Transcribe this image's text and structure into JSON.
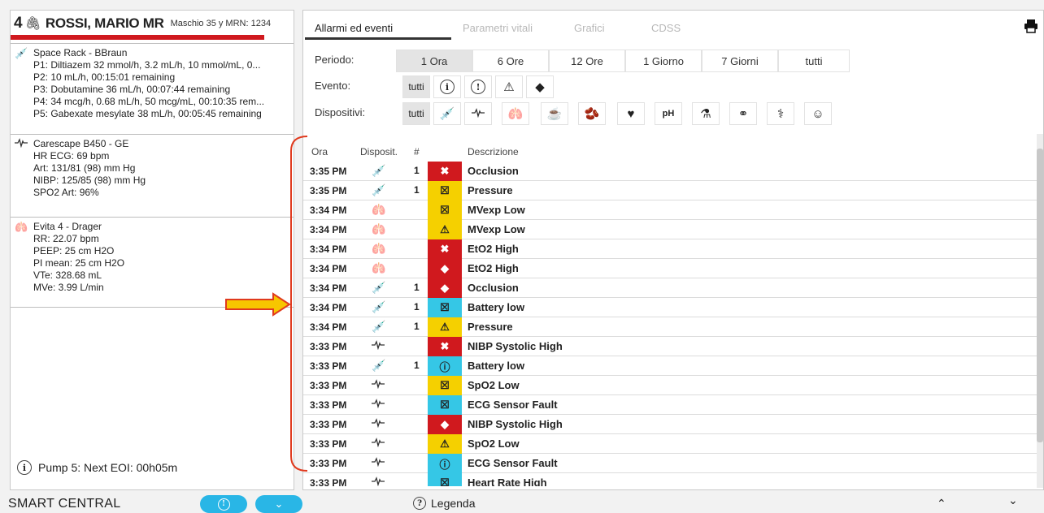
{
  "patient": {
    "bed": "4",
    "name": "ROSSI, MARIO MR",
    "info": "Maschio 35 y MRN: 1234"
  },
  "devices": [
    {
      "icon": "syringe-icon",
      "title": "Space Rack - BBraun",
      "lines": [
        "P1: Diltiazem 32 mmol/h, 3.2 mL/h, 10 mmol/mL, 0...",
        "P2: 10 mL/h, 00:15:01 remaining",
        "P3: Dobutamine 36 mL/h, 00:07:44 remaining",
        "P4: 34 mcg/h, 0.68 mL/h, 50 mcg/mL, 00:10:35 rem...",
        "P5: Gabexate mesylate 38 mL/h, 00:05:45 remaining"
      ]
    },
    {
      "icon": "ecg-waveform-icon",
      "title": "Carescape B450 - GE",
      "lines": [
        "HR ECG: 69 bpm",
        "Art: 131/81 (98) mm Hg",
        "NIBP: 125/85 (98) mm Hg",
        "SPO2 Art: 96%"
      ]
    },
    {
      "icon": "lungs-icon",
      "title": "Evita 4 - Drager",
      "lines": [
        "RR: 22.07 bpm",
        "PEEP: 25 cm H2O",
        "PI mean: 25 cm H2O",
        "VTe: 328.68 mL",
        "MVe: 3.99 L/min"
      ]
    }
  ],
  "eoi_text": "Pump 5: Next EOI: 00h05m",
  "tabs": [
    "Allarmi ed eventi",
    "Parametri vitali",
    "Grafici",
    "CDSS"
  ],
  "filters": {
    "periodo_label": "Periodo:",
    "periodo_options": [
      "1 Ora",
      "6 Ore",
      "12 Ore",
      "1 Giorno",
      "7 Giorni",
      "tutti"
    ],
    "evento_label": "Evento:",
    "evento_all": "tutti",
    "evento_icons": [
      "info-icon",
      "alert-circle-icon",
      "warning-triangle-icon",
      "critical-diamond-icon"
    ],
    "dispositivi_label": "Dispositivi:",
    "dispositivi_all": "tutti",
    "dispositivi_icons": [
      "syringe-icon",
      "ecg-waveform-icon",
      "lungs-icon",
      "nutrition-pump-icon",
      "kidney-icon",
      "heart-icon",
      "ph-icon",
      "flask-icon",
      "bandage-icon",
      "stethoscope-icon",
      "person-icon"
    ],
    "ph_text": "pH"
  },
  "table": {
    "headers": [
      "Ora",
      "Disposit.",
      "#",
      "Descrizione"
    ],
    "rows": [
      {
        "time": "3:35 PM",
        "device": "syringe",
        "num": "1",
        "sev": "red-cross",
        "desc": "Occlusion"
      },
      {
        "time": "3:35 PM",
        "device": "syringe",
        "num": "1",
        "sev": "yellow-x",
        "desc": "Pressure"
      },
      {
        "time": "3:34 PM",
        "device": "lungs",
        "num": "",
        "sev": "yellow-x",
        "desc": "MVexp Low"
      },
      {
        "time": "3:34 PM",
        "device": "lungs",
        "num": "",
        "sev": "yellow-warn",
        "desc": "MVexp Low"
      },
      {
        "time": "3:34 PM",
        "device": "lungs",
        "num": "",
        "sev": "red-cross",
        "desc": "EtO2 High"
      },
      {
        "time": "3:34 PM",
        "device": "lungs",
        "num": "",
        "sev": "red-diamond",
        "desc": "EtO2 High"
      },
      {
        "time": "3:34 PM",
        "device": "syringe",
        "num": "1",
        "sev": "red-diamond",
        "desc": "Occlusion"
      },
      {
        "time": "3:34 PM",
        "device": "syringe",
        "num": "1",
        "sev": "blue-x",
        "desc": "Battery low"
      },
      {
        "time": "3:34 PM",
        "device": "syringe",
        "num": "1",
        "sev": "yellow-warn",
        "desc": "Pressure"
      },
      {
        "time": "3:33 PM",
        "device": "ecg",
        "num": "",
        "sev": "red-cross",
        "desc": "NIBP Systolic High"
      },
      {
        "time": "3:33 PM",
        "device": "syringe",
        "num": "1",
        "sev": "blue-circle",
        "desc": "Battery low"
      },
      {
        "time": "3:33 PM",
        "device": "ecg",
        "num": "",
        "sev": "yellow-x",
        "desc": "SpO2 Low"
      },
      {
        "time": "3:33 PM",
        "device": "ecg",
        "num": "",
        "sev": "blue-x",
        "desc": "ECG Sensor Fault"
      },
      {
        "time": "3:33 PM",
        "device": "ecg",
        "num": "",
        "sev": "red-diamond",
        "desc": "NIBP Systolic High"
      },
      {
        "time": "3:33 PM",
        "device": "ecg",
        "num": "",
        "sev": "yellow-warn",
        "desc": "SpO2 Low"
      },
      {
        "time": "3:33 PM",
        "device": "ecg",
        "num": "",
        "sev": "blue-circle",
        "desc": "ECG Sensor Fault"
      },
      {
        "time": "3:33 PM",
        "device": "ecg",
        "num": "",
        "sev": "blue-x",
        "desc": "Heart Rate High"
      }
    ]
  },
  "bottom": {
    "app_name": "SMART CENTRAL",
    "legend": "Legenda"
  },
  "colors": {
    "red": "#d0191e",
    "yellow": "#f5d000",
    "blue": "#35c7e6",
    "accent": "#29b6e6",
    "annotation": "#e03a1e",
    "arrow_fill": "#f7c600"
  }
}
